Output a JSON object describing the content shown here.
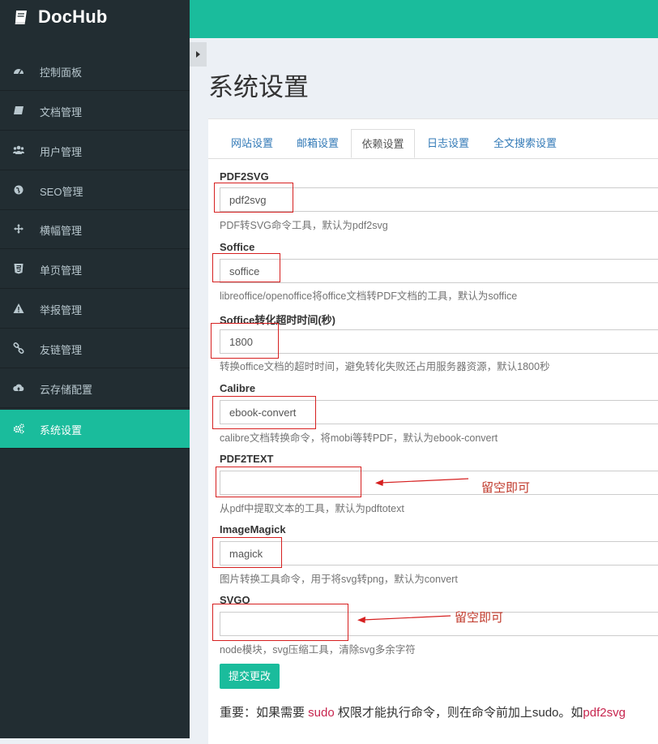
{
  "brand": {
    "name": "DocHub",
    "icon": "book-icon"
  },
  "sidebar": {
    "items": [
      {
        "label": "控制面板",
        "icon": "dashboard-icon",
        "active": false
      },
      {
        "label": "文档管理",
        "icon": "book-icon",
        "active": false
      },
      {
        "label": "用户管理",
        "icon": "users-icon",
        "active": false
      },
      {
        "label": "SEO管理",
        "icon": "globe-icon",
        "active": false
      },
      {
        "label": "横幅管理",
        "icon": "arrows-icon",
        "active": false
      },
      {
        "label": "单页管理",
        "icon": "html5-icon",
        "active": false
      },
      {
        "label": "举报管理",
        "icon": "warning-icon",
        "active": false
      },
      {
        "label": "友链管理",
        "icon": "link-icon",
        "active": false
      },
      {
        "label": "云存储配置",
        "icon": "cloud-upload-icon",
        "active": false
      },
      {
        "label": "系统设置",
        "icon": "cogs-icon",
        "active": true
      }
    ]
  },
  "header": {
    "accent": "#1abc9c"
  },
  "page": {
    "title": "系统设置"
  },
  "tabs": [
    {
      "label": "网站设置",
      "active": false
    },
    {
      "label": "邮箱设置",
      "active": false
    },
    {
      "label": "依赖设置",
      "active": true
    },
    {
      "label": "日志设置",
      "active": false
    },
    {
      "label": "全文搜索设置",
      "active": false
    }
  ],
  "fields": [
    {
      "label": "PDF2SVG",
      "value": "pdf2svg",
      "help": "PDF转SVG命令工具，默认为pdf2svg"
    },
    {
      "label": "Soffice",
      "value": "soffice",
      "help": "libreoffice/openoffice将office文档转PDF文档的工具，默认为soffice"
    },
    {
      "label": "Soffice转化超时时间(秒)",
      "value": "1800",
      "help": "转换office文档的超时时间，避免转化失败还占用服务器资源，默认1800秒"
    },
    {
      "label": "Calibre",
      "value": "ebook-convert",
      "help": "calibre文档转换命令，将mobi等转PDF，默认为ebook-convert"
    },
    {
      "label": "PDF2TEXT",
      "value": "",
      "help": "从pdf中提取文本的工具，默认为pdftotext"
    },
    {
      "label": "ImageMagick",
      "value": "magick",
      "help": "图片转换工具命令，用于将svg转png，默认为convert"
    },
    {
      "label": "SVGO",
      "value": "",
      "help": "node模块，svg压缩工具，清除svg多余字符"
    }
  ],
  "annotations": [
    "留空即可",
    "留空即可"
  ],
  "submit_label": "提交更改",
  "note": {
    "prefix": "重要：如果需要 ",
    "sudo": "sudo",
    "middle": " 权限才能执行命令，则在命令前加上sudo。如",
    "example": "pdf2svg"
  }
}
